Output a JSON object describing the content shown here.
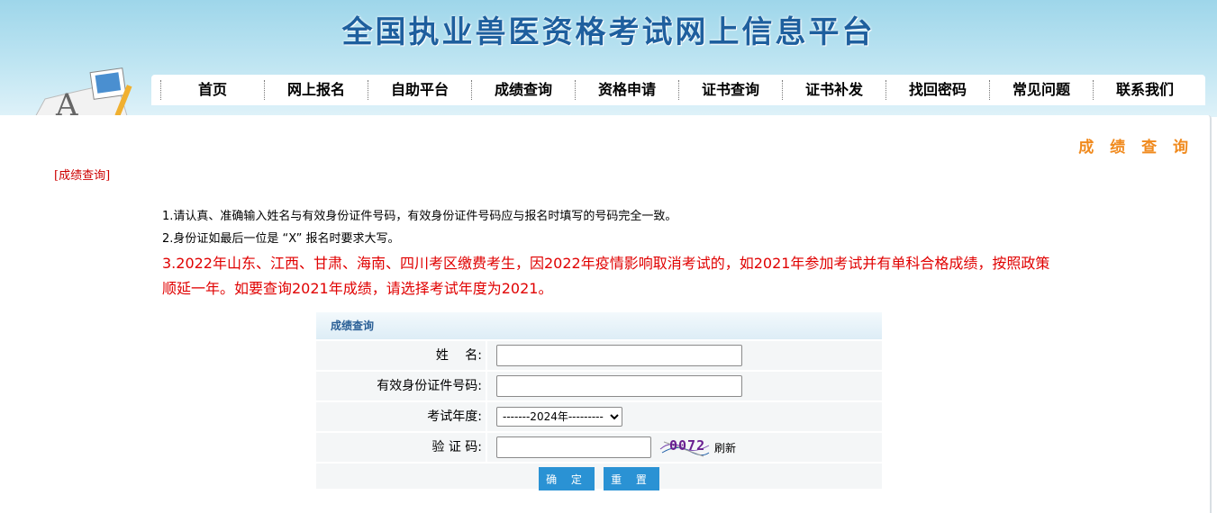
{
  "site": {
    "title": "全国执业兽医资格考试网上信息平台"
  },
  "nav": {
    "items": [
      "首页",
      "网上报名",
      "自助平台",
      "成绩查询",
      "资格申请",
      "证书查询",
      "证书补发",
      "找回密码",
      "常见问题",
      "联系我们"
    ]
  },
  "page": {
    "heading": "成 绩 查 询",
    "section_tag": "[成绩查询]"
  },
  "notes": {
    "line1": "1.请认真、准确输入姓名与有效身份证件号码，有效身份证件号码应与报名时填写的号码完全一致。",
    "line2": "2.身份证如最后一位是 “X” 报名时要求大写。",
    "line3": "3.2022年山东、江西、甘肃、海南、四川考区缴费考生，因2022年疫情影响取消考试的，如2021年参加考试并有单科合格成绩，按照政策顺延一年。如要查询2021年成绩，请选择考试年度为2021。"
  },
  "form": {
    "title": "成绩查询",
    "name_label": "姓　 名:",
    "name_value": "",
    "id_label": "有效身份证件号码:",
    "id_value": "",
    "year_label": "考试年度:",
    "year_selected": "-------2024年---------",
    "captcha_label": "验 证 码:",
    "captcha_value": "",
    "captcha_text": "0072",
    "refresh_label": "刷新",
    "submit_label": "确 定",
    "reset_label": "重 置"
  },
  "colors": {
    "title": "#1e5f9e",
    "heading": "#f08a1e",
    "red_note": "#e00000",
    "button": "#2a92d4"
  }
}
